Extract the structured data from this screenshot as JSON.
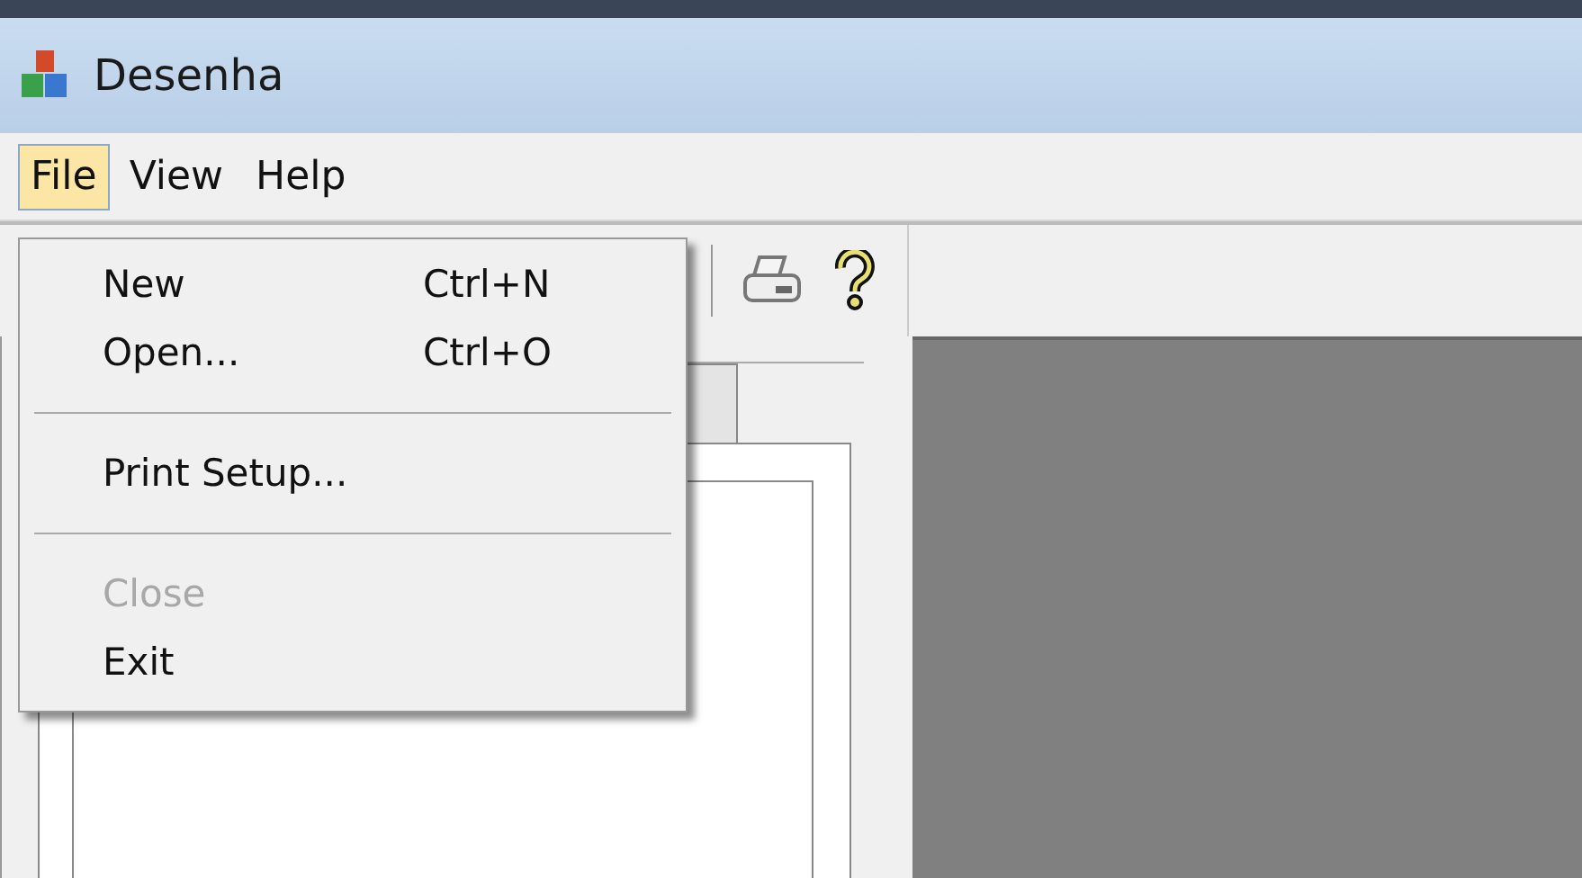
{
  "window": {
    "title": "Desenha"
  },
  "menubar": [
    {
      "label": "File",
      "selected": true
    },
    {
      "label": "View",
      "selected": false
    },
    {
      "label": "Help",
      "selected": false
    }
  ],
  "file_menu": [
    {
      "kind": "item",
      "label": "New",
      "shortcut": "Ctrl+N",
      "disabled": false
    },
    {
      "kind": "item",
      "label": "Open...",
      "shortcut": "Ctrl+O",
      "disabled": false
    },
    {
      "kind": "separator"
    },
    {
      "kind": "item",
      "label": "Print Setup...",
      "disabled": false
    },
    {
      "kind": "separator"
    },
    {
      "kind": "item",
      "label": "Close",
      "disabled": true
    },
    {
      "kind": "item",
      "label": "Exit",
      "disabled": false
    }
  ]
}
